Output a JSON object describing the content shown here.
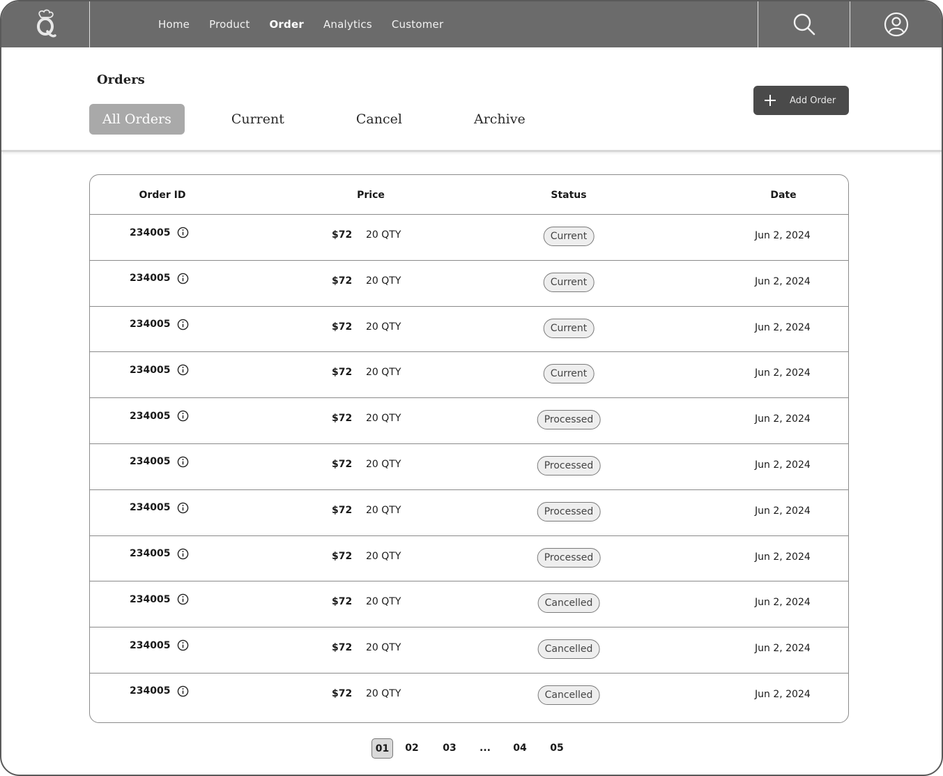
{
  "nav": {
    "items": [
      {
        "label": "Home",
        "active": false
      },
      {
        "label": "Product",
        "active": false
      },
      {
        "label": "Order",
        "active": true
      },
      {
        "label": "Analytics",
        "active": false
      },
      {
        "label": "Customer",
        "active": false
      }
    ],
    "icons": {
      "logo": "chef-logo-icon",
      "search": "search-icon",
      "profile": "user-icon"
    }
  },
  "page": {
    "title": "Orders",
    "tabs": [
      {
        "label": "All Orders",
        "active": true
      },
      {
        "label": "Current",
        "active": false
      },
      {
        "label": "Cancel",
        "active": false
      },
      {
        "label": "Archive",
        "active": false
      }
    ],
    "add_button": "Add Order"
  },
  "table": {
    "headers": {
      "order_id": "Order ID",
      "price": "Price",
      "status": "Status",
      "date": "Date"
    },
    "rows": [
      {
        "order_id": "234005",
        "price": "$72",
        "qty": "20 QTY",
        "status": "Current",
        "date": "Jun 2, 2024"
      },
      {
        "order_id": "234005",
        "price": "$72",
        "qty": "20 QTY",
        "status": "Current",
        "date": "Jun 2, 2024"
      },
      {
        "order_id": "234005",
        "price": "$72",
        "qty": "20 QTY",
        "status": "Current",
        "date": "Jun 2, 2024"
      },
      {
        "order_id": "234005",
        "price": "$72",
        "qty": "20 QTY",
        "status": "Current",
        "date": "Jun 2, 2024"
      },
      {
        "order_id": "234005",
        "price": "$72",
        "qty": "20 QTY",
        "status": "Processed",
        "date": "Jun 2, 2024"
      },
      {
        "order_id": "234005",
        "price": "$72",
        "qty": "20 QTY",
        "status": "Processed",
        "date": "Jun 2, 2024"
      },
      {
        "order_id": "234005",
        "price": "$72",
        "qty": "20 QTY",
        "status": "Processed",
        "date": "Jun 2, 2024"
      },
      {
        "order_id": "234005",
        "price": "$72",
        "qty": "20 QTY",
        "status": "Processed",
        "date": "Jun 2, 2024"
      },
      {
        "order_id": "234005",
        "price": "$72",
        "qty": "20 QTY",
        "status": "Cancelled",
        "date": "Jun 2, 2024"
      },
      {
        "order_id": "234005",
        "price": "$72",
        "qty": "20 QTY",
        "status": "Cancelled",
        "date": "Jun 2, 2024"
      },
      {
        "order_id": "234005",
        "price": "$72",
        "qty": "20 QTY",
        "status": "Cancelled",
        "date": "Jun 2, 2024"
      }
    ]
  },
  "pagination": {
    "pages": [
      "01",
      "02",
      "03",
      "...",
      "04",
      "05"
    ],
    "current": "01"
  }
}
